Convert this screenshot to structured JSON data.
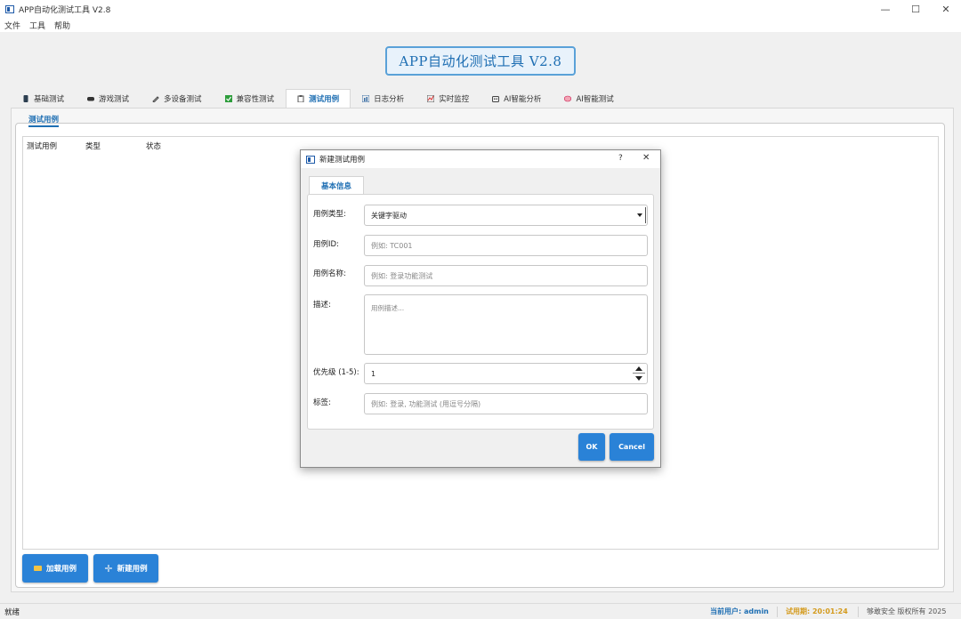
{
  "window": {
    "title": "APP自动化测试工具 V2.8",
    "controls": {
      "minimize": "—",
      "maximize": "☐",
      "close": "✕"
    }
  },
  "menu": [
    "文件",
    "工具",
    "帮助"
  ],
  "banner": {
    "title": "APP自动化测试工具 V2.8"
  },
  "tabs": [
    {
      "label": "基础测试",
      "icon": "phone-icon"
    },
    {
      "label": "游戏测试",
      "icon": "gamepad-icon"
    },
    {
      "label": "多设备测试",
      "icon": "pen-icon"
    },
    {
      "label": "兼容性测试",
      "icon": "check-icon"
    },
    {
      "label": "测试用例",
      "icon": "clipboard-icon",
      "active": true
    },
    {
      "label": "日志分析",
      "icon": "chart-icon"
    },
    {
      "label": "实时监控",
      "icon": "monitor-icon"
    },
    {
      "label": "AI智能分析",
      "icon": "robot-icon"
    },
    {
      "label": "AI智能测试",
      "icon": "brain-icon"
    }
  ],
  "testcases": {
    "group_title": "测试用例",
    "columns": [
      "测试用例",
      "类型",
      "状态"
    ],
    "load_button": "加载用例",
    "new_button": "新建用例"
  },
  "dialog": {
    "title": "新建测试用例",
    "help": "?",
    "close": "✕",
    "tab": "基本信息",
    "fields": {
      "type": {
        "label": "用例类型:",
        "value": "关键字驱动"
      },
      "id": {
        "label": "用例ID:",
        "placeholder": "例如: TC001"
      },
      "name": {
        "label": "用例名称:",
        "placeholder": "例如: 登录功能测试"
      },
      "description": {
        "label": "描述:",
        "placeholder": "用例描述..."
      },
      "priority": {
        "label": "优先级 (1-5):",
        "value": "1"
      },
      "tags": {
        "label": "标签:",
        "placeholder": "例如: 登录, 功能测试 (用逗号分隔)"
      }
    },
    "ok_button": "OK",
    "cancel_button": "Cancel"
  },
  "statusbar": {
    "status": "就绪",
    "user": "当前用户: admin",
    "trial": "试用期: 20:01:24",
    "copyright": "够敢安全 版权所有 2025"
  },
  "colors": {
    "accent": "#1f6fb3",
    "button": "#2a82d7",
    "trial": "#d49a1c"
  }
}
